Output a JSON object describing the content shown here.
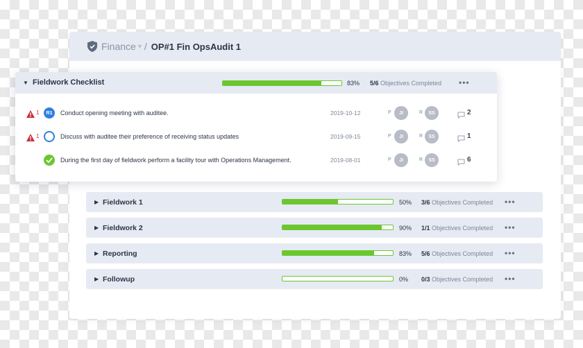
{
  "breadcrumb": {
    "parent": "Finance",
    "separator": "/",
    "title": "OP#1 Fin OpsAudit 1"
  },
  "checklist": {
    "title": "Fieldwork Checklist",
    "progress_percent": 83,
    "progress_label": "83%",
    "objectives_count": "5/6",
    "objectives_word": "Objectives Completed",
    "more_label": "•••",
    "tasks": [
      {
        "warning_count": "1",
        "status": "R1",
        "text": "Conduct opening meeting with auditee.",
        "date": "2019-10-12",
        "preparer_role": "P",
        "preparer_initials": "JI",
        "reviewer_role": "R",
        "reviewer_initials": "SS",
        "comments": "2"
      },
      {
        "warning_count": "1",
        "status": "open",
        "text": "Discuss with auditee their preference of receiving status updates",
        "date": "2019-09-15",
        "preparer_role": "P",
        "preparer_initials": "JI",
        "reviewer_role": "R",
        "reviewer_initials": "SS",
        "comments": "1"
      },
      {
        "warning_count": "",
        "status": "done",
        "text": "During the first day of fieldwork perform a facility tour with Operations Management.",
        "date": "2019-08-01",
        "preparer_role": "P",
        "preparer_initials": "JI",
        "reviewer_role": "R",
        "reviewer_initials": "SS",
        "comments": "6"
      }
    ]
  },
  "sections": [
    {
      "title": "Fieldwork 1",
      "progress_percent": 50,
      "progress_label": "50%",
      "objectives_count": "3/6",
      "objectives_word": "Objectives Completed",
      "more_label": "•••"
    },
    {
      "title": "Fieldwork 2",
      "progress_percent": 90,
      "progress_label": "90%",
      "objectives_count": "1/1",
      "objectives_word": "Objectives Completed",
      "more_label": "•••"
    },
    {
      "title": "Reporting",
      "progress_percent": 83,
      "progress_label": "83%",
      "objectives_count": "5/6",
      "objectives_word": "Objectives Completed",
      "more_label": "•••"
    },
    {
      "title": "Followup",
      "progress_percent": 0,
      "progress_label": "0%",
      "objectives_count": "0/3",
      "objectives_word": "Objectives Completed",
      "more_label": "•••"
    }
  ],
  "colors": {
    "progress": "#6cc72f",
    "accent_blue": "#2f7fe0",
    "warning": "#c9303a",
    "header_bg": "#e6eaf3"
  }
}
